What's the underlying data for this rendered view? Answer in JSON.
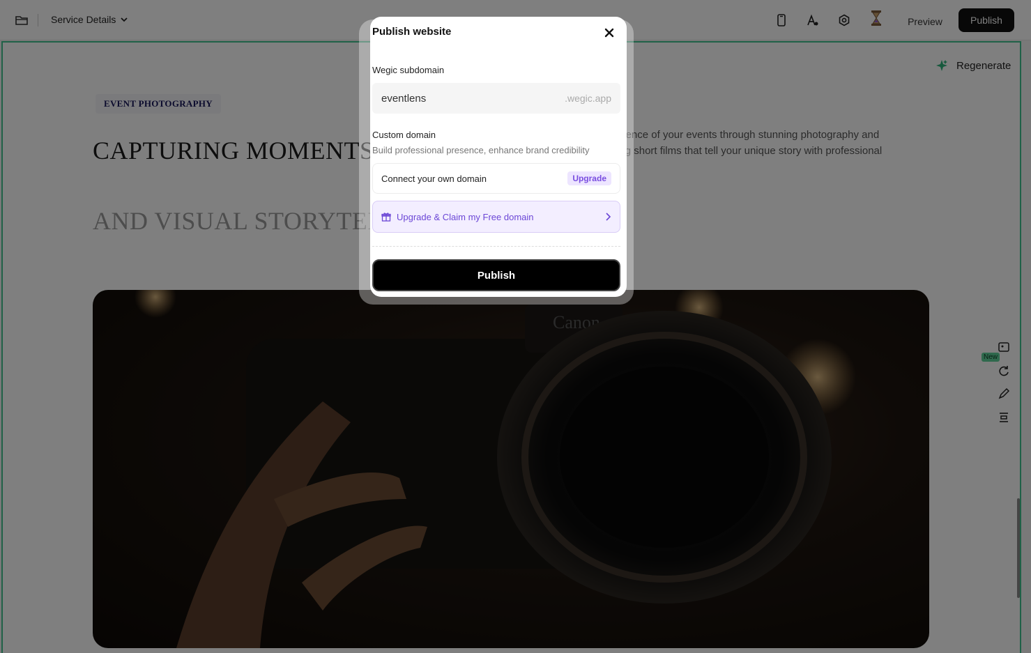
{
  "topbar": {
    "page_selector": "Service Details",
    "preview_label": "Preview",
    "publish_label": "Publish"
  },
  "canvas": {
    "regenerate_label": "Regenerate",
    "badge": "EVENT PHOTOGRAPHY",
    "headline": "CAPTURING MOMENTS WITH ARTISTRY",
    "subheadline": "AND VISUAL STORYTELLING",
    "description": "Capturing the essence of your events through stunning photography and crafting compelling short films that tell your unique story with professional precision.",
    "new_badge": "New"
  },
  "modal": {
    "title": "Publish website",
    "subdomain_label": "Wegic subdomain",
    "subdomain_value": "eventlens",
    "subdomain_suffix": ".wegic.app",
    "custom_domain_label": "Custom domain",
    "custom_domain_sub": "Build professional presence, enhance brand credibility",
    "connect_label": "Connect your own domain",
    "upgrade_badge": "Upgrade",
    "claim_label": "Upgrade & Claim my Free domain",
    "publish_label": "Publish"
  },
  "colors": {
    "accent_green": "#3ec28f",
    "upgrade_purple": "#7a4ee0",
    "publish_black": "#000000"
  }
}
